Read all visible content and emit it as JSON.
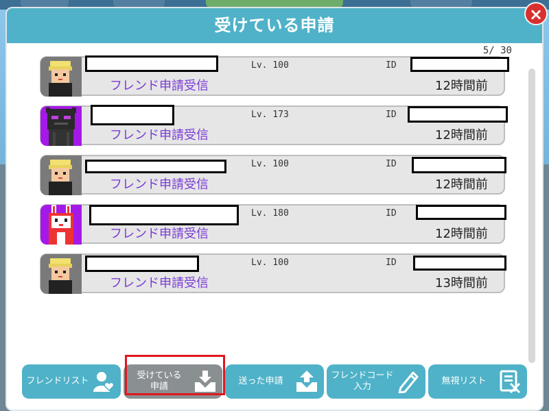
{
  "dialog": {
    "title": "受けている申請",
    "close_label": "×",
    "counter": "5/ 30"
  },
  "requests": [
    {
      "avatar": "blond-boy-avatar",
      "level": "Lv. 100",
      "id_label": "ID",
      "status": "フレンド申請受信",
      "time": "12時間前"
    },
    {
      "avatar": "dark-monster-avatar",
      "level": "Lv. 173",
      "id_label": "ID",
      "status": "フレンド申請受信",
      "time": "12時間前"
    },
    {
      "avatar": "blond-boy-avatar",
      "level": "Lv. 100",
      "id_label": "ID",
      "status": "フレンド申請受信",
      "time": "12時間前"
    },
    {
      "avatar": "red-rabbit-avatar",
      "level": "Lv. 180",
      "id_label": "ID",
      "status": "フレンド申請受信",
      "time": "12時間前"
    },
    {
      "avatar": "blond-boy-avatar",
      "level": "Lv. 100",
      "id_label": "ID",
      "status": "フレンド申請受信",
      "time": "13時間前"
    }
  ],
  "tabs": [
    {
      "label": "フレンドリスト",
      "icon": "friend-heart-icon",
      "active": false
    },
    {
      "label": "受けている\n申請",
      "icon": "inbox-download-icon",
      "active": true
    },
    {
      "label": "送った申請",
      "icon": "outbox-upload-icon",
      "active": false
    },
    {
      "label": "フレンドコード\n入力",
      "icon": "pencil-icon",
      "active": false
    },
    {
      "label": "無視リスト",
      "icon": "ignore-list-icon",
      "active": false
    }
  ],
  "colors": {
    "header": "#4fb2c8",
    "status_text": "#7a3bd6",
    "active_tab": "#8a8f92",
    "highlight": "#e0161e",
    "close": "#d8302f"
  }
}
